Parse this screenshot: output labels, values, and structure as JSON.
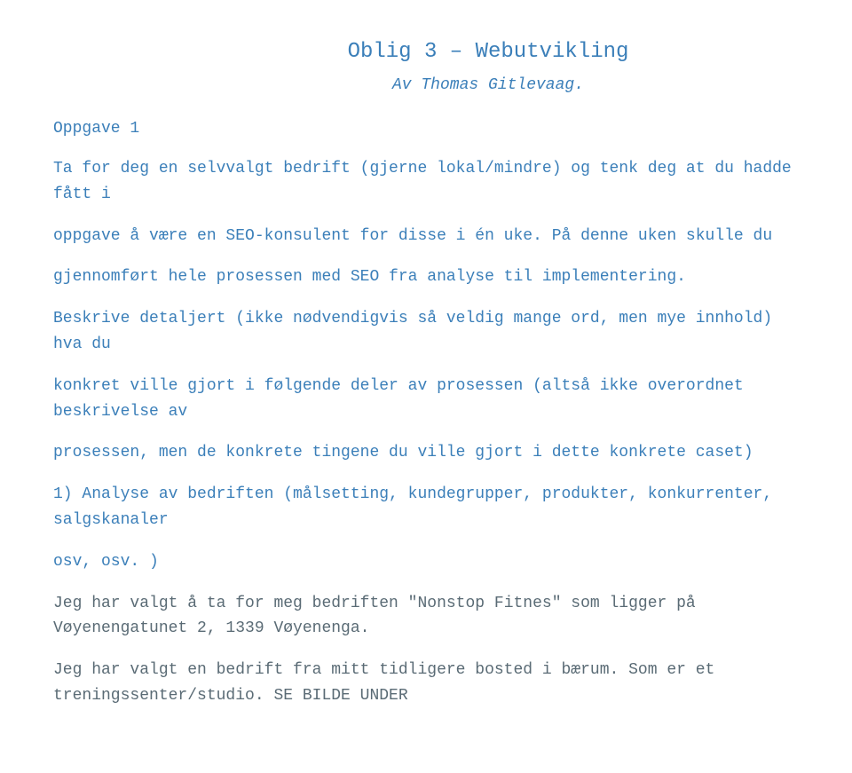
{
  "document": {
    "title": "Oblig 3 – Webutvikling",
    "subtitle": "Av Thomas Gitlevaag.",
    "heading1": "Oppgave 1",
    "p1": "Ta for deg en selvvalgt bedrift (gjerne lokal/mindre) og tenk deg at du hadde fått i",
    "p2": "oppgave å være en SEO-konsulent for disse i én uke. På denne uken skulle du",
    "p3": "gjennomført hele prosessen med SEO fra analyse til implementering.",
    "p4": "Beskrive detaljert (ikke nødvendigvis så veldig mange ord, men mye innhold) hva du",
    "p5": "konkret ville gjort i følgende deler av prosessen (altså ikke overordnet beskrivelse av",
    "p6": "prosessen, men de konkrete tingene du ville gjort i dette konkrete caset)",
    "p7": "1) Analyse av bedriften (målsetting, kundegrupper, produkter, konkurrenter, salgskanaler",
    "p8": "osv, osv. )",
    "p9a": "Jeg har valgt å ta for meg bedriften ",
    "p9b": "\"Nonstop Fitnes\"",
    "p9c": " som ligger på Vøyenengatunet 2, 1339 Vøyenenga.",
    "p10": "Jeg har valgt en bedrift fra mitt tidligere bosted i bærum. Som er et treningssenter/studio. SE BILDE UNDER"
  }
}
